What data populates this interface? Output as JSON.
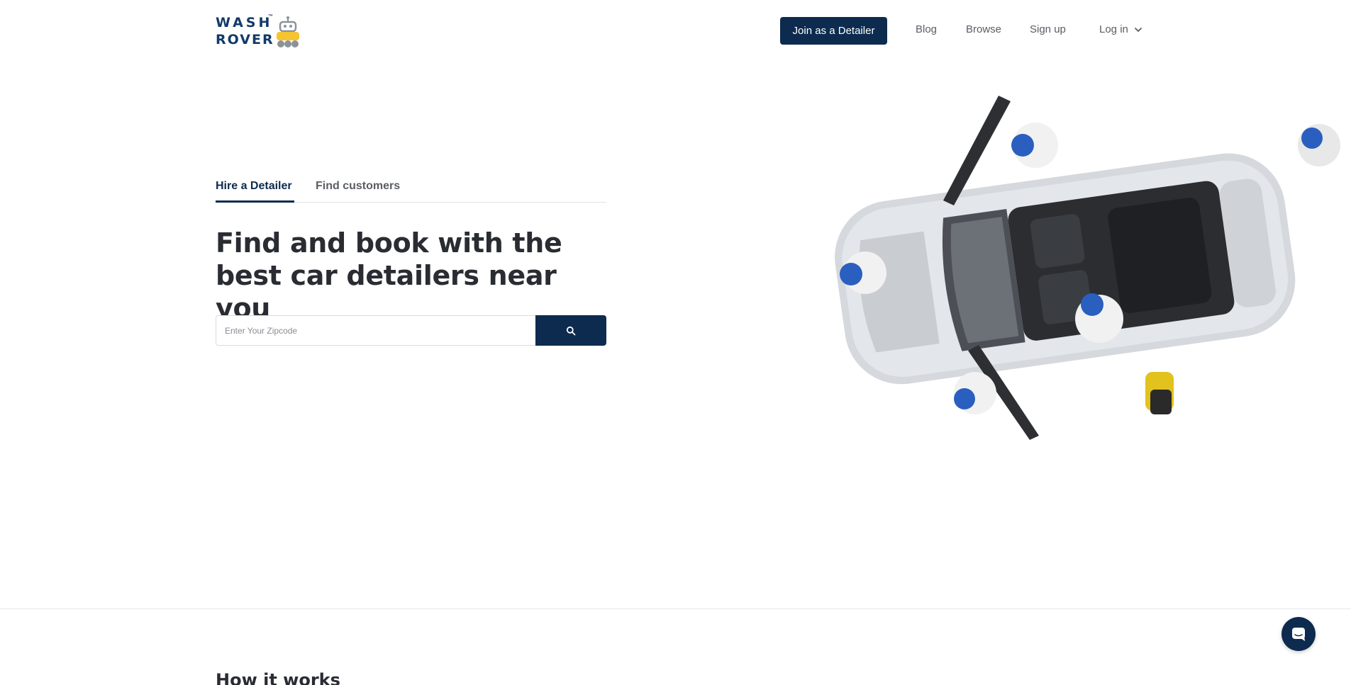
{
  "brand": {
    "line1": "WASH",
    "line2": "ROVER",
    "tm": "™",
    "primary_color": "#0d2b4e",
    "logo_blue": "#123a6b",
    "logo_yellow": "#f4c531"
  },
  "nav": {
    "join_label": "Join as a Detailer",
    "blog_label": "Blog",
    "browse_label": "Browse",
    "signup_label": "Sign up",
    "login_label": "Log in",
    "login_icon": "chevron-down-icon"
  },
  "hero": {
    "tabs": [
      {
        "label": "Hire a Detailer",
        "active": true
      },
      {
        "label": "Find customers",
        "active": false
      }
    ],
    "headline": "Find and book with the best car detailers near you",
    "search": {
      "placeholder": "Enter Your Zipcode",
      "value": "",
      "button_icon": "search-icon"
    }
  },
  "how_it_works": {
    "title": "How it works"
  },
  "chat": {
    "icon": "chat-icon"
  }
}
